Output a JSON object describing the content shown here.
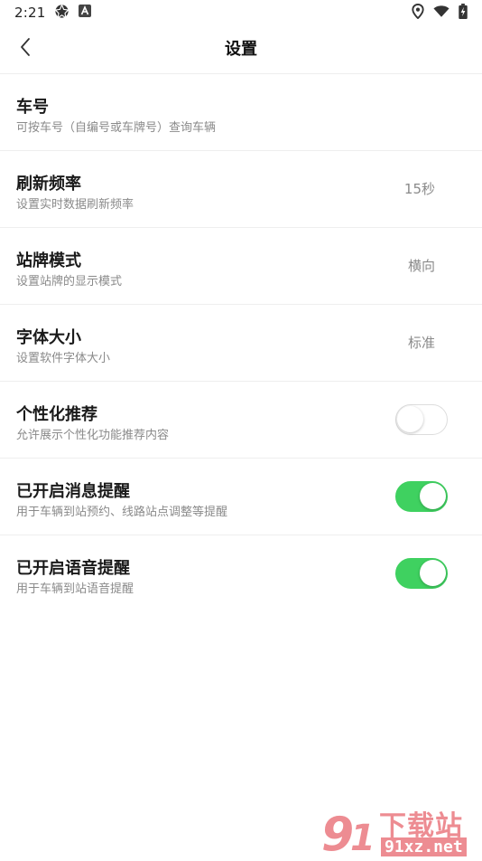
{
  "status_bar": {
    "time": "2:21",
    "left_icons": [
      "aperture-icon",
      "a-badge-icon"
    ],
    "right_icons": [
      "location-icon",
      "wifi-icon",
      "battery-charging-icon"
    ]
  },
  "app_bar": {
    "title": "设置",
    "back_icon": "chevron-left-icon"
  },
  "settings": [
    {
      "title": "车号",
      "subtitle": "可按车号（自编号或车牌号）查询车辆",
      "value": ""
    },
    {
      "title": "刷新频率",
      "subtitle": "设置实时数据刷新频率",
      "value": "15秒"
    },
    {
      "title": "站牌模式",
      "subtitle": "设置站牌的显示模式",
      "value": "横向"
    },
    {
      "title": "字体大小",
      "subtitle": "设置软件字体大小",
      "value": "标准"
    },
    {
      "title": "个性化推荐",
      "subtitle": "允许展示个性化功能推荐内容",
      "toggle": false
    },
    {
      "title": "已开启消息提醒",
      "subtitle": "用于车辆到站预约、线路站点调整等提醒",
      "toggle": true
    },
    {
      "title": "已开启语音提醒",
      "subtitle": "用于车辆到站语音提醒",
      "toggle": true
    }
  ],
  "watermark": {
    "brand": "下载站",
    "domain": "91xz.net"
  },
  "colors": {
    "toggle_on": "#3fd160",
    "divider": "#eeeeee",
    "watermark": "#e0303a"
  }
}
